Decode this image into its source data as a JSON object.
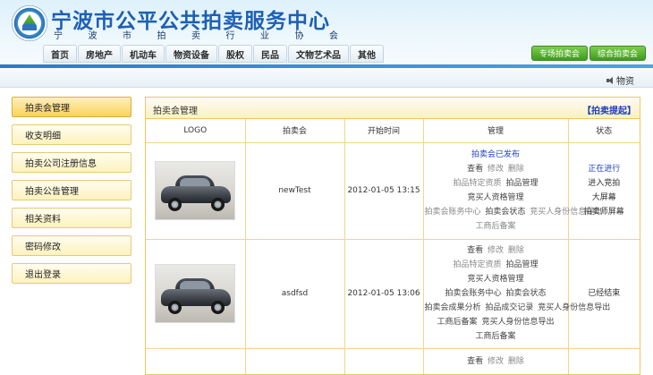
{
  "header": {
    "site_title": "宁波市公平公共拍卖服务中心",
    "subtitle_chars": [
      "宁",
      "波",
      "市",
      "拍",
      "卖",
      "行",
      "业",
      "协",
      "会"
    ]
  },
  "nav": {
    "items": [
      "首页",
      "房地产",
      "机动车",
      "物资设备",
      "股权",
      "民品",
      "文物艺术品",
      "其他"
    ],
    "buttons": [
      "专场拍卖会",
      "综合拍卖会"
    ]
  },
  "ticker": {
    "text": "物资"
  },
  "sidebar": {
    "items": [
      "拍卖会管理",
      "收支明细",
      "拍卖公司注册信息",
      "拍卖公告管理",
      "相关资料",
      "密码修改",
      "退出登录"
    ]
  },
  "panel": {
    "title": "拍卖会管理",
    "action_link": "【拍卖提起】",
    "columns": [
      "LOGO",
      "拍卖会",
      "开始时间",
      "管理",
      "状态"
    ],
    "rows": [
      {
        "name": "newTest",
        "time": "2012-01-05 13:15",
        "published": "拍卖会已发布",
        "ops": {
          "view": "查看",
          "edit": "修改",
          "delete": "删除",
          "fixed_lot": "拍品特定资质",
          "lot_mgmt": "拍品管理",
          "bidder_qual": "竞买人资格管理",
          "account_center": "拍卖会账务中心",
          "auction_status": "拍卖会状态",
          "bidder_info": "竞买人身份信息导出",
          "commerce_record": "工商后备案"
        },
        "status": {
          "state": "正在进行",
          "enter": "进入竞拍",
          "big_screen": "大屏幕",
          "auctioneer_screen": "拍卖师屏幕"
        }
      },
      {
        "name": "asdfsd",
        "time": "2012-01-05 13:06",
        "ops": {
          "view": "查看",
          "edit": "修改",
          "delete": "删除",
          "fixed_lot": "拍品特定资质",
          "lot_mgmt": "拍品管理",
          "bidder_qual": "竞买人资格管理",
          "account_center": "拍卖会账务中心",
          "auction_status": "拍卖会状态",
          "result_analysis": "拍卖会成果分析",
          "deal_record": "拍品成交记录",
          "bidder_info": "竞买人身份信息导出",
          "commerce_record": "工商后备案",
          "bidder_info2": "竞买人身份信息导出",
          "commerce_record2": "工商后备案"
        },
        "status": {
          "state": "已经结束"
        }
      },
      {
        "ops": {
          "view": "查看",
          "edit": "修改",
          "delete": "删除"
        }
      }
    ]
  }
}
